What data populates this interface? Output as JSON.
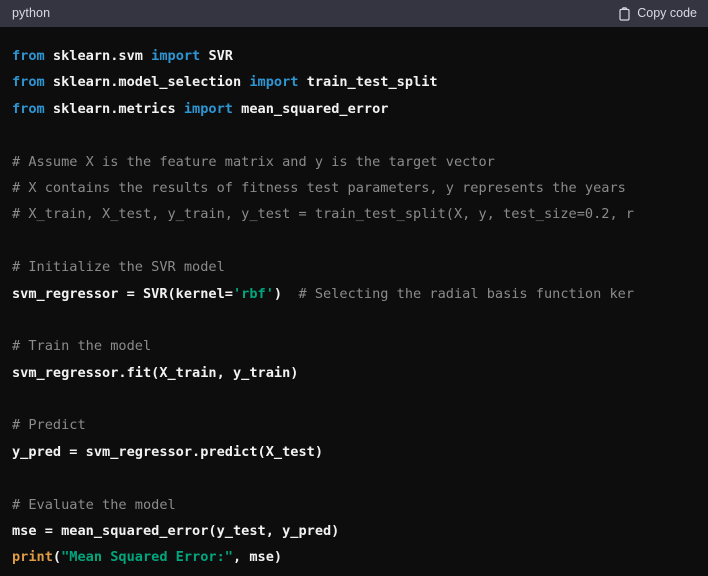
{
  "header": {
    "language": "python",
    "copy_label": "Copy code",
    "copy_icon": "clipboard-icon"
  },
  "colors": {
    "header_bg": "#343541",
    "code_bg": "#0d0d0d",
    "text": "#f2f2f2",
    "keyword": "#2e95d3",
    "comment": "#8b8b8b",
    "string": "#00a67d",
    "function": "#df9c45",
    "header_text": "#d9d9e3"
  },
  "code": {
    "language": "python",
    "lines": [
      [
        {
          "t": "from ",
          "c": "kw"
        },
        {
          "t": "sklearn.svm ",
          "c": "plain"
        },
        {
          "t": "import ",
          "c": "kw"
        },
        {
          "t": "SVR",
          "c": "plain"
        }
      ],
      [
        {
          "t": "from ",
          "c": "kw"
        },
        {
          "t": "sklearn.model_selection ",
          "c": "plain"
        },
        {
          "t": "import ",
          "c": "kw"
        },
        {
          "t": "train_test_split",
          "c": "plain"
        }
      ],
      [
        {
          "t": "from ",
          "c": "kw"
        },
        {
          "t": "sklearn.metrics ",
          "c": "plain"
        },
        {
          "t": "import ",
          "c": "kw"
        },
        {
          "t": "mean_squared_error",
          "c": "plain"
        }
      ],
      [],
      [
        {
          "t": "# Assume X is the feature matrix and y is the target vector",
          "c": "comment"
        }
      ],
      [
        {
          "t": "# X contains the results of fitness test parameters, y represents the years",
          "c": "comment"
        }
      ],
      [
        {
          "t": "# X_train, X_test, y_train, y_test = train_test_split(X, y, test_size=0.2, r",
          "c": "comment"
        }
      ],
      [],
      [
        {
          "t": "# Initialize the SVR model",
          "c": "comment"
        }
      ],
      [
        {
          "t": "svm_regressor = SVR(kernel=",
          "c": "plain"
        },
        {
          "t": "'rbf'",
          "c": "str"
        },
        {
          "t": ")",
          "c": "plain"
        },
        {
          "t": "  # Selecting the radial basis function ker",
          "c": "comment"
        }
      ],
      [],
      [
        {
          "t": "# Train the model",
          "c": "comment"
        }
      ],
      [
        {
          "t": "svm_regressor.fit(X_train, y_train)",
          "c": "plain"
        }
      ],
      [],
      [
        {
          "t": "# Predict",
          "c": "comment"
        }
      ],
      [
        {
          "t": "y_pred = svm_regressor.predict(X_test)",
          "c": "plain"
        }
      ],
      [],
      [
        {
          "t": "# Evaluate the model",
          "c": "comment"
        }
      ],
      [
        {
          "t": "mse = mean_squared_error(y_test, y_pred)",
          "c": "plain"
        }
      ],
      [
        {
          "t": "print",
          "c": "fn"
        },
        {
          "t": "(",
          "c": "plain"
        },
        {
          "t": "\"Mean Squared Error:\"",
          "c": "str"
        },
        {
          "t": ", mse)",
          "c": "plain"
        }
      ]
    ]
  }
}
